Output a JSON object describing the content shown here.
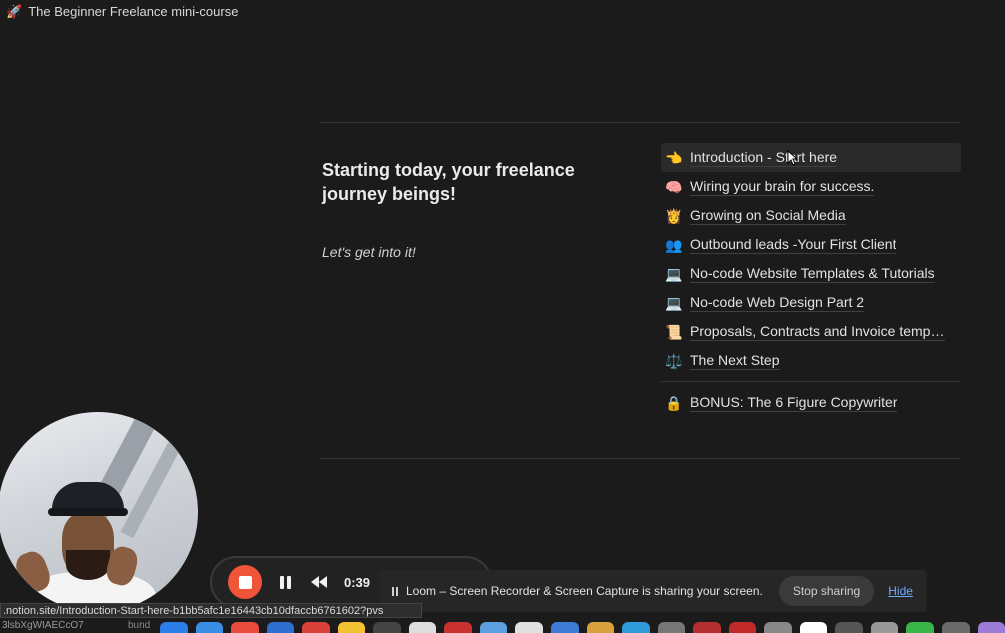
{
  "breadcrumb": {
    "emoji": "🚀",
    "title": "The Beginner Freelance mini-course"
  },
  "page": {
    "headline": "Starting today, your freelance journey beings!",
    "subline": "Let's get into it!"
  },
  "links": [
    {
      "icon": "👈",
      "label": "Introduction - Start here"
    },
    {
      "icon": "🧠",
      "label": "Wiring your brain for success."
    },
    {
      "icon": "👸",
      "label": "Growing on Social Media"
    },
    {
      "icon": "👥",
      "label": "Outbound leads -Your First Client"
    },
    {
      "icon": "💻",
      "label": "No-code Website Templates & Tutorials"
    },
    {
      "icon": "💻",
      "label": "No-code Web Design Part 2"
    },
    {
      "icon": "📜",
      "label": "Proposals, Contracts and Invoice templates"
    },
    {
      "icon": "⚖️",
      "label": "The Next Step"
    }
  ],
  "bonus_link": {
    "icon": "🔒",
    "label": "BONUS: The 6 Figure Copywriter"
  },
  "loom": {
    "timer": "0:39",
    "share_text": "Loom – Screen Recorder & Screen Capture is sharing your screen.",
    "stop_sharing": "Stop sharing",
    "hide": "Hide"
  },
  "status_url": ".notion.site/Introduction-Start-here-b1bb5afc1e16443cb10dfaccb6761602?pvs",
  "under_text": "3lsbXgWIAECcO7",
  "under_text2": "bund",
  "colors": {
    "background": "#1b1b1b",
    "stop_button": "#f0553a",
    "hide_link": "#6ea8ff"
  },
  "dock_colors": [
    "#2b7de9",
    "#3a8ee6",
    "#e64b3c",
    "#2f6ecf",
    "#d8403a",
    "#f2c230",
    "#444",
    "#dddddd",
    "#c93030",
    "#5aa0e0",
    "#e0e0e0",
    "#3d7bd4",
    "#d9a13c",
    "#2e9ad8",
    "#777",
    "#b43030",
    "#c02a2a",
    "#888",
    "#ffffff",
    "#555",
    "#999",
    "#39b54a",
    "#6a6a6a",
    "#9b7ad8"
  ]
}
